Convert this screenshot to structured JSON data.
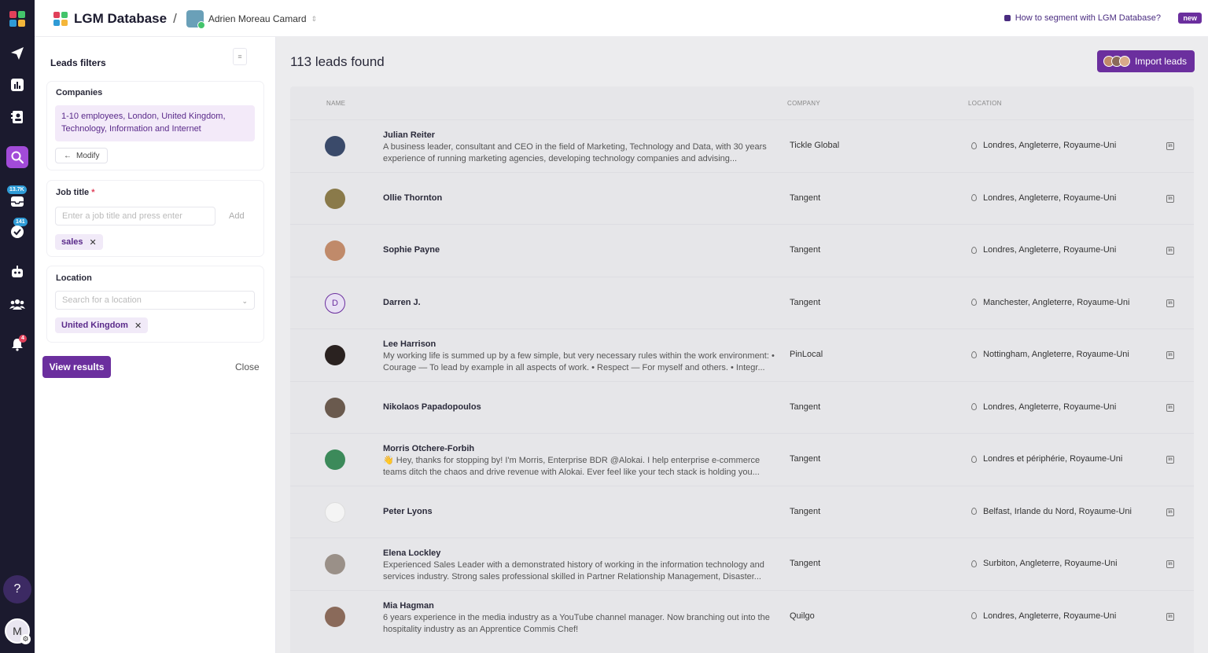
{
  "app": {
    "title": "LGM Database",
    "separator": "/",
    "user_name": "Adrien Moreau Camard",
    "help_link": "How to segment with LGM Database?",
    "new_badge": "new"
  },
  "rail": {
    "inbox_badge": "13.7K",
    "tasks_badge": "141",
    "notif_badge": "4",
    "help_label": "?",
    "me_initial": "M"
  },
  "filters": {
    "title": "Leads filters",
    "companies_label": "Companies",
    "companies_summary": "1-10 employees, London, United Kingdom, Technology, Information and Internet",
    "modify_label": "Modify",
    "job_title_label": "Job title",
    "job_title_required": "*",
    "job_title_placeholder": "Enter a job title and press enter",
    "add_label": "Add",
    "job_chip": "sales",
    "location_label": "Location",
    "location_placeholder": "Search for a location",
    "location_chip": "United Kingdom",
    "view_results": "View results",
    "close": "Close"
  },
  "main": {
    "count_text": "113 leads found",
    "import_label": "Import leads",
    "columns": {
      "name": "NAME",
      "company": "COMPANY",
      "location": "LOCATION"
    }
  },
  "leads": [
    {
      "name": "Julian Reiter",
      "desc": "A business leader, consultant and CEO in the field of Marketing, Technology and Data, with 30 years experience of running marketing agencies, developing technology companies and advising...",
      "company": "Tickle Global",
      "location": "Londres, Angleterre, Royaume-Uni",
      "avatar_color": "#3a4a6a"
    },
    {
      "name": "Ollie Thornton",
      "desc": "",
      "company": "Tangent",
      "location": "Londres, Angleterre, Royaume-Uni",
      "avatar_color": "#8a7a4a"
    },
    {
      "name": "Sophie Payne",
      "desc": "",
      "company": "Tangent",
      "location": "Londres, Angleterre, Royaume-Uni",
      "avatar_color": "#c08a6a"
    },
    {
      "name": "Darren J.",
      "desc": "",
      "company": "Tangent",
      "location": "Manchester, Angleterre, Royaume-Uni",
      "avatar_letter": "D"
    },
    {
      "name": "Lee Harrison",
      "desc": "My working life is summed up by a few simple, but very necessary rules within the work environment: • Courage — To lead by example in all aspects of work. • Respect — For myself and others. • Integr...",
      "company": "PinLocal",
      "location": "Nottingham, Angleterre, Royaume-Uni",
      "avatar_color": "#2a2220"
    },
    {
      "name": "Nikolaos Papadopoulos",
      "desc": "",
      "company": "Tangent",
      "location": "Londres, Angleterre, Royaume-Uni",
      "avatar_color": "#6a5a4e"
    },
    {
      "name": "Morris Otchere-Forbih",
      "desc": "👋 Hey, thanks for stopping by! I'm Morris, Enterprise BDR @Alokai. I help enterprise e-commerce teams ditch the chaos and drive revenue with Alokai. Ever feel like your tech stack is holding you...",
      "company": "Tangent",
      "location": "Londres et périphérie, Royaume-Uni",
      "avatar_color": "#3c8a5a"
    },
    {
      "name": "Peter Lyons",
      "desc": "",
      "company": "Tangent",
      "location": "Belfast, Irlande du Nord, Royaume-Uni",
      "avatar_color": "#f4f4f4"
    },
    {
      "name": "Elena Lockley",
      "desc": "Experienced Sales Leader with a demonstrated history of working in the information technology and services industry. Strong sales professional skilled in Partner Relationship Management, Disaster...",
      "company": "Tangent",
      "location": "Surbiton, Angleterre, Royaume-Uni",
      "avatar_color": "#9a9088"
    },
    {
      "name": "Mia Hagman",
      "desc": "6 years experience in the media industry as a YouTube channel manager. Now branching out into the hospitality industry as an Apprentice Commis Chef!",
      "company": "Quilgo",
      "location": "Londres, Angleterre, Royaume-Uni",
      "avatar_color": "#8a6a5a"
    }
  ],
  "colors": {
    "accent": "#6b2f9e",
    "rail_bg": "#1b1a2e",
    "active_rail": "#a24bd8"
  }
}
